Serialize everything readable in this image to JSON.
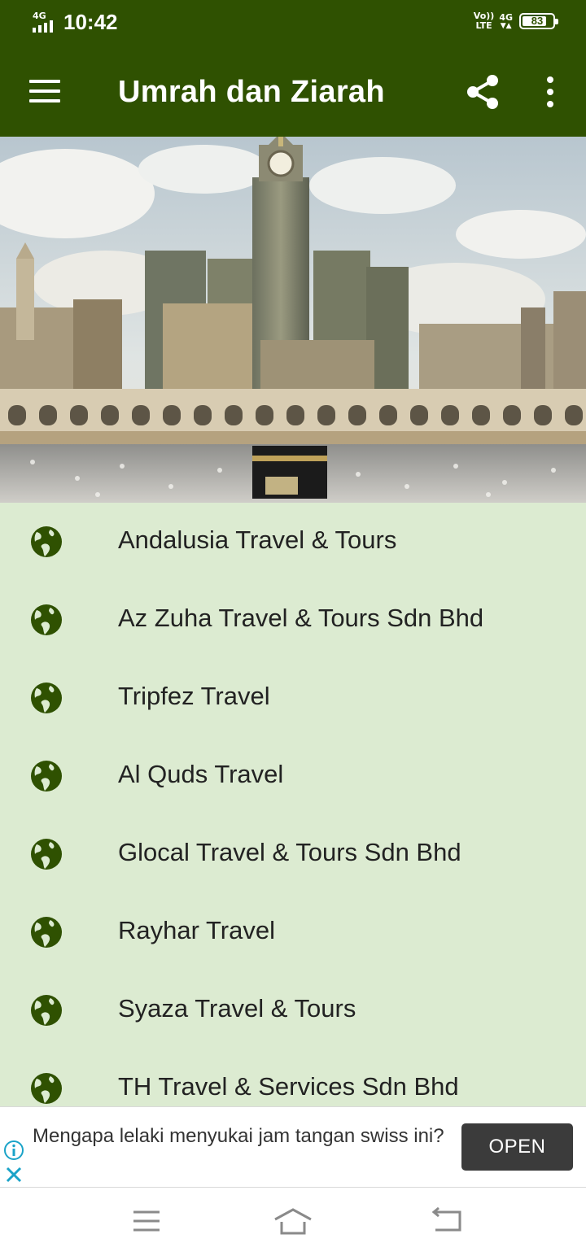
{
  "status_bar": {
    "network_type": "4G",
    "time": "10:42",
    "volte_top": "Vo))",
    "volte_bottom": "LTE",
    "network_4g": "4G",
    "battery_level": "83"
  },
  "app_bar": {
    "title": "Umrah dan Ziarah",
    "menu_icon": "hamburger-menu-icon",
    "share_icon": "share-icon",
    "more_icon": "more-vertical-icon"
  },
  "hero": {
    "icon": "mecca-clock-tower-photo"
  },
  "list": {
    "item_icon": "globe-icon",
    "items": [
      {
        "label": "Andalusia Travel & Tours"
      },
      {
        "label": "Az Zuha Travel & Tours Sdn Bhd"
      },
      {
        "label": "Tripfez Travel"
      },
      {
        "label": "Al Quds Travel"
      },
      {
        "label": "Glocal Travel & Tours Sdn Bhd"
      },
      {
        "label": "Rayhar Travel"
      },
      {
        "label": "Syaza Travel & Tours"
      },
      {
        "label": "TH Travel & Services Sdn Bhd"
      }
    ]
  },
  "ad": {
    "text": "Mengapa lelaki menyukai jam tangan swiss ini?",
    "button_label": "OPEN",
    "accent_color": "#1aa3c8"
  },
  "colors": {
    "primary": "#2f5101",
    "list_background": "#dcebd1",
    "icon": "#2f5101"
  },
  "navigation": {
    "menu_icon": "recent-apps-icon",
    "home_icon": "home-icon",
    "back_icon": "back-icon"
  }
}
